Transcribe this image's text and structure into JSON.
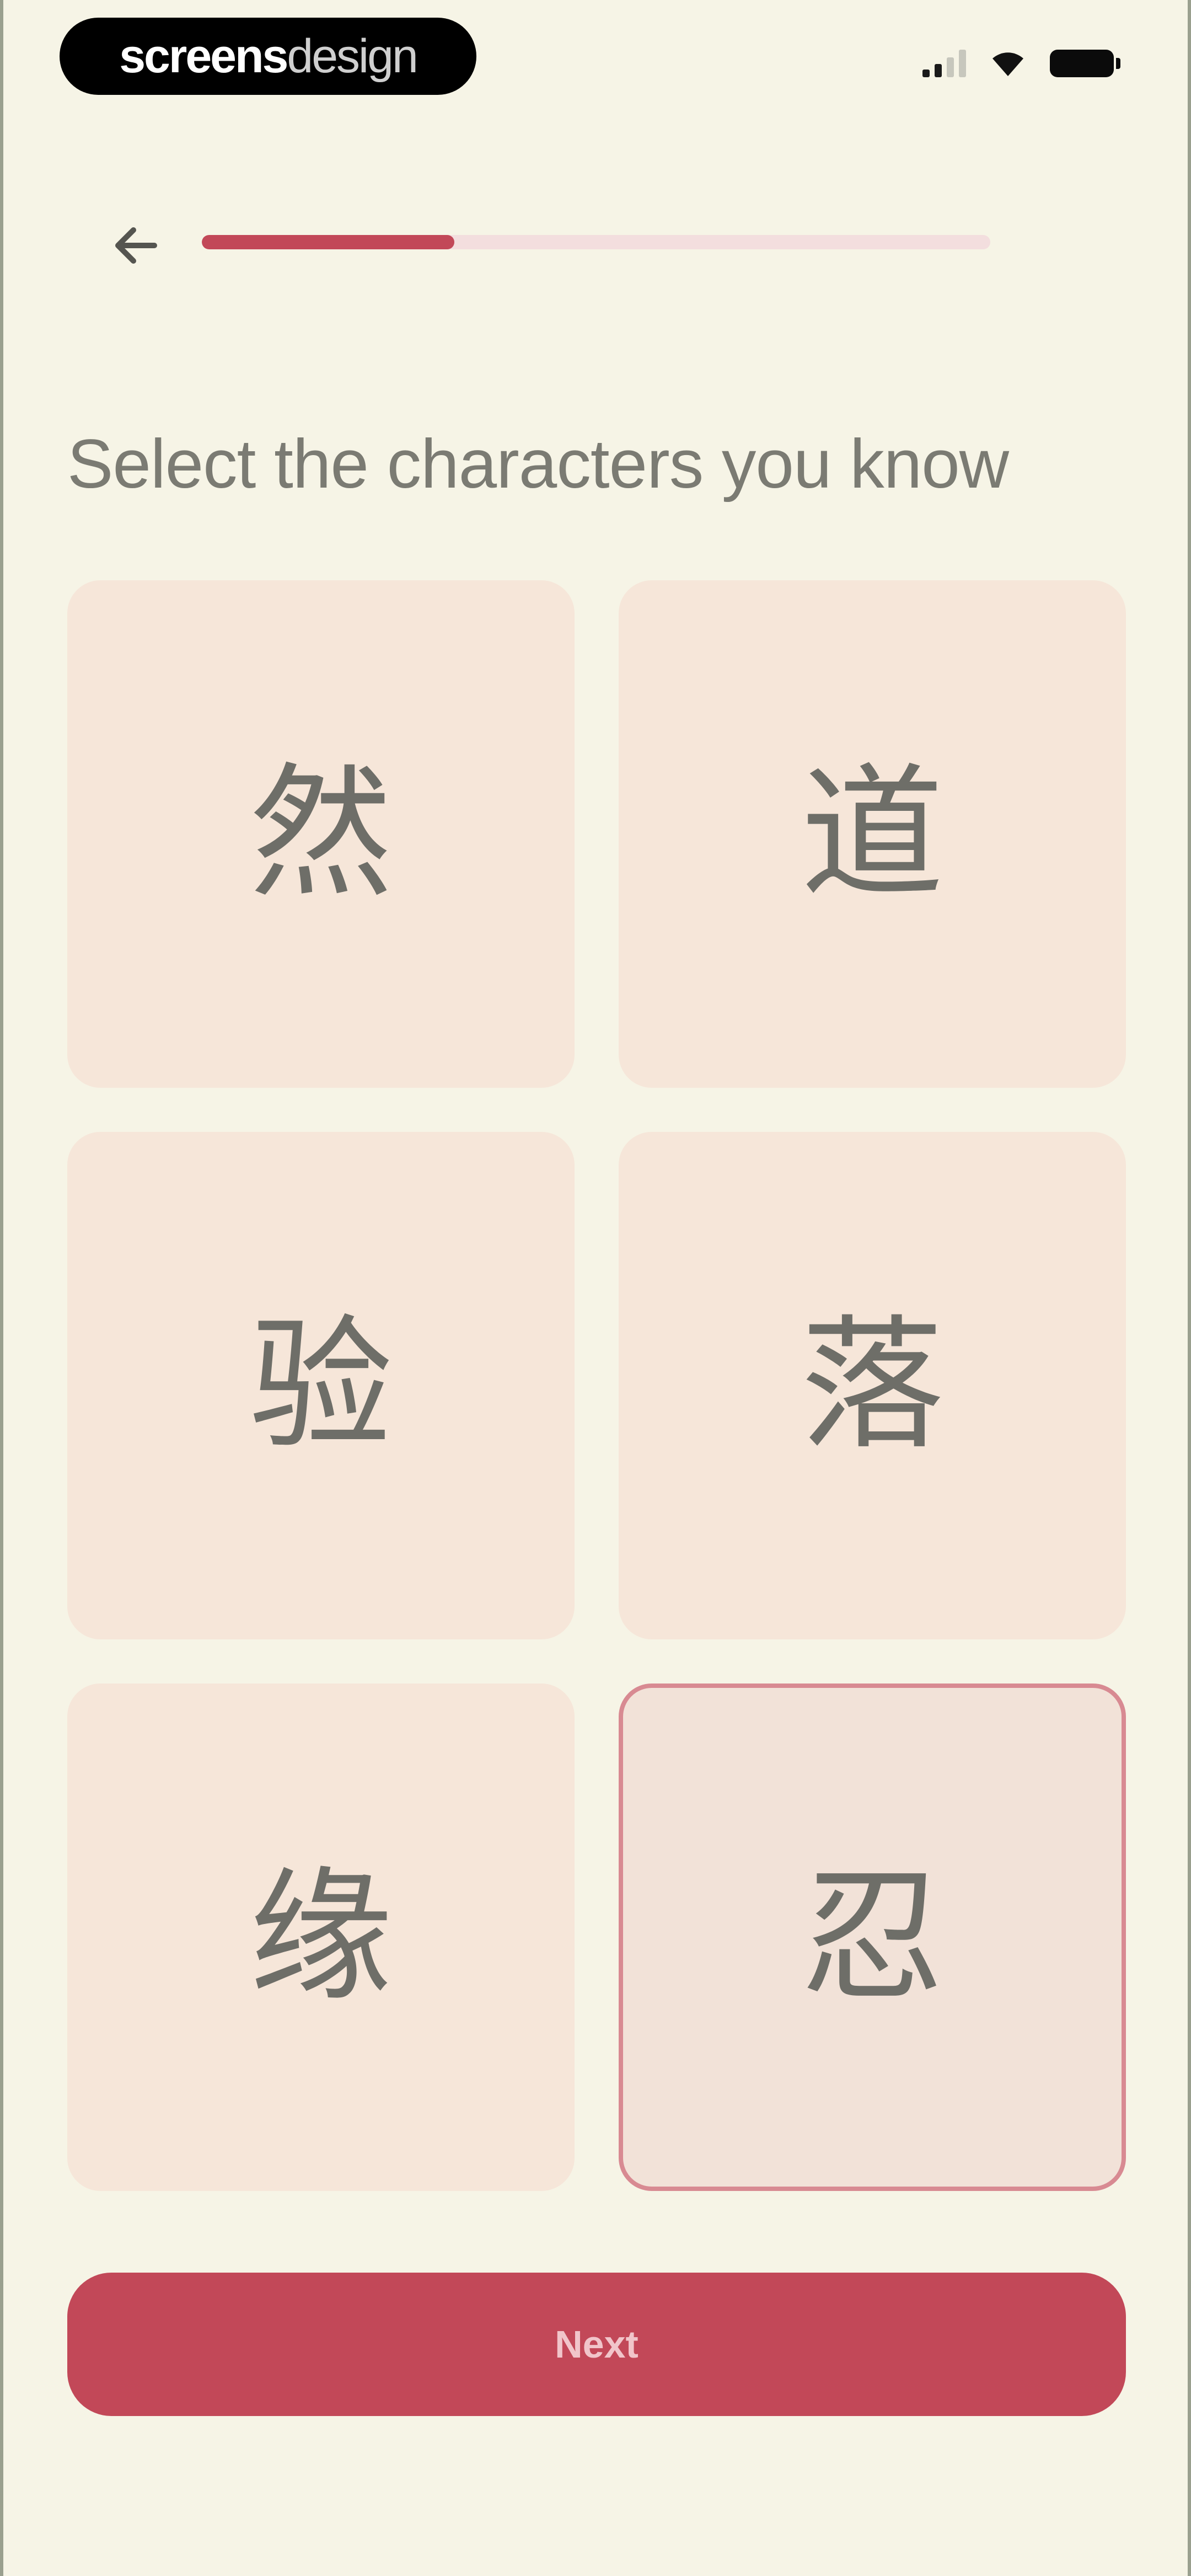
{
  "status_bar": {
    "brand_bold": "screens",
    "brand_light": "design",
    "icons": [
      "signal-icon",
      "wifi-icon",
      "battery-icon"
    ]
  },
  "nav": {
    "back_icon": "arrow-left-icon",
    "progress": 0.32
  },
  "title": "Select the characters you know",
  "characters": [
    {
      "glyph": "然",
      "selected": false
    },
    {
      "glyph": "道",
      "selected": false
    },
    {
      "glyph": "验",
      "selected": false
    },
    {
      "glyph": "落",
      "selected": false
    },
    {
      "glyph": "缘",
      "selected": false
    },
    {
      "glyph": "忍",
      "selected": true
    }
  ],
  "next_button": {
    "label": "Next"
  },
  "colors": {
    "background": "#f6f4e6",
    "accent": "#c24858",
    "card": "#f6e6d9",
    "selected_border": "#d88a92",
    "progress_track": "#f3dede",
    "text": "#7b7b73"
  }
}
